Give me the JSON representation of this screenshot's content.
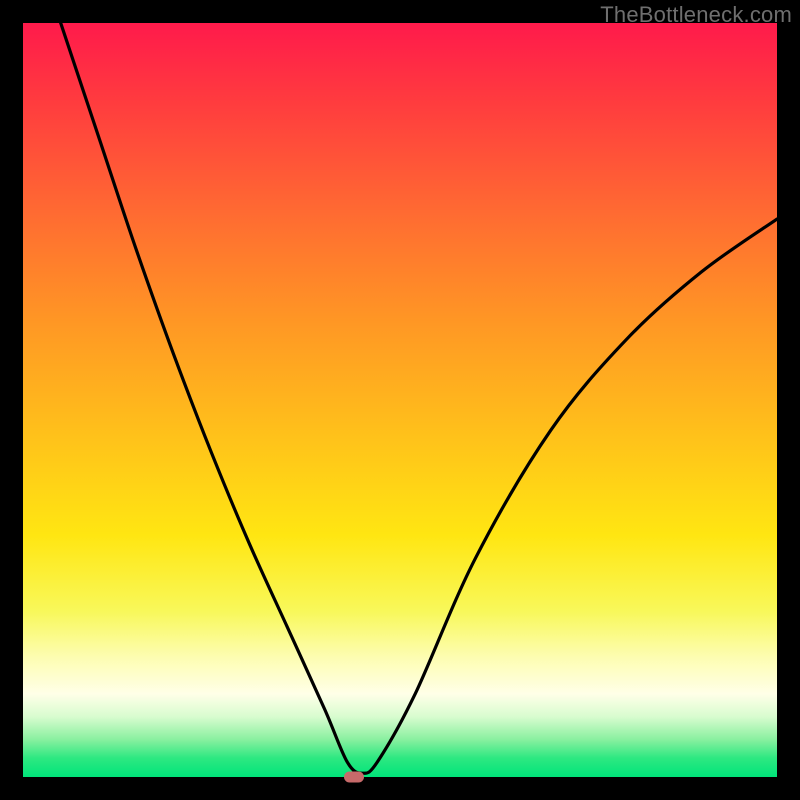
{
  "watermark": "TheBottleneck.com",
  "chart_data": {
    "type": "line",
    "title": "",
    "xlabel": "",
    "ylabel": "",
    "xlim": [
      0,
      1
    ],
    "ylim": [
      0,
      1
    ],
    "legend": false,
    "grid": false,
    "annotations": [
      {
        "name": "minimum-marker",
        "x": 0.439,
        "y": 0.0
      }
    ],
    "series": [
      {
        "name": "bottleneck-curve",
        "color": "#000000",
        "x": [
          0.05,
          0.1,
          0.15,
          0.2,
          0.25,
          0.3,
          0.35,
          0.4,
          0.43,
          0.45,
          0.47,
          0.52,
          0.6,
          0.7,
          0.8,
          0.9,
          1.0
        ],
        "y": [
          1.0,
          0.85,
          0.7,
          0.56,
          0.43,
          0.31,
          0.2,
          0.09,
          0.02,
          0.005,
          0.02,
          0.11,
          0.29,
          0.46,
          0.58,
          0.67,
          0.74
        ]
      }
    ]
  }
}
